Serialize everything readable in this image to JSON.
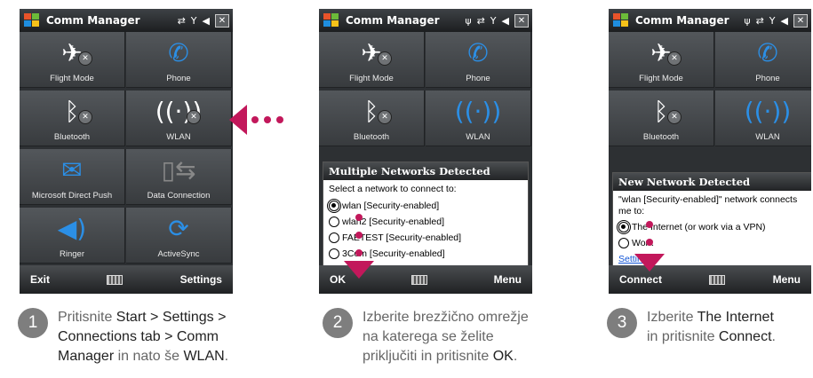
{
  "app_title": "Comm Manager",
  "tiles": {
    "flight": "Flight Mode",
    "phone": "Phone",
    "bluetooth": "Bluetooth",
    "wlan": "WLAN",
    "push": "Microsoft Direct Push",
    "data": "Data Connection",
    "ringer": "Ringer",
    "activesync": "ActiveSync"
  },
  "softkeys": {
    "exit": "Exit",
    "settings": "Settings",
    "ok": "OK",
    "menu": "Menu",
    "connect": "Connect"
  },
  "dialog_multi": {
    "title": "Multiple Networks Detected",
    "prompt": "Select a network to connect to:",
    "options": [
      "wlan [Security-enabled]",
      "wlan2 [Security-enabled]",
      "FAETEST [Security-enabled]",
      "3Com [Security-enabled]"
    ]
  },
  "dialog_new": {
    "title": "New Network Detected",
    "message": "\"wlan [Security-enabled]\" network connects me to:",
    "options": [
      "The Internet (or work via a VPN)",
      "Work"
    ],
    "settings_link": "Settings"
  },
  "steps": [
    {
      "num": "1",
      "t1": "Pritisnite ",
      "b1": "Start > Settings >",
      "b2": "Connections tab > Comm",
      "b3": "Manager",
      "t2": " in nato še ",
      "b4": "WLAN",
      "t3": "."
    },
    {
      "num": "2",
      "l1": "Izberite brezžično omrežje",
      "l2": "na katerega se želite",
      "l3": "priključiti in pritisnite ",
      "b1": "OK",
      "t1": "."
    },
    {
      "num": "3",
      "t1": "Izberite ",
      "b1": "The Internet",
      "t2": "in pritisnite ",
      "b2": "Connect",
      "t3": "."
    }
  ],
  "colors": {
    "accent": "#c2185b",
    "wlan_active": "#2b8fe6",
    "step_circle": "#7e7e7e"
  }
}
